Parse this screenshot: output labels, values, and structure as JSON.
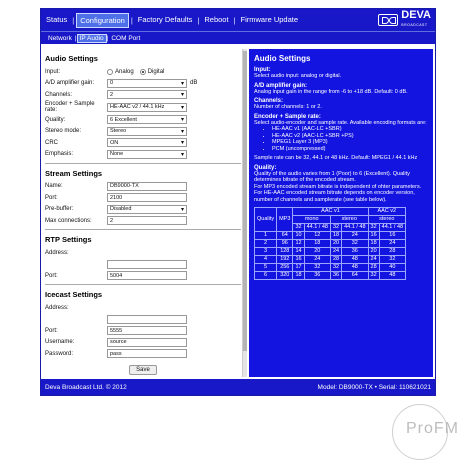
{
  "nav": {
    "items": [
      "Status",
      "Configuration",
      "Factory Defaults",
      "Reboot",
      "Firmware Update"
    ],
    "active_index": 1,
    "logo_text": "DEVA",
    "logo_sub": "BROADCAST"
  },
  "subnav": {
    "items": [
      "Network",
      "IP Audio",
      "COM Port"
    ],
    "active_index": 1
  },
  "audio": {
    "title": "Audio Settings",
    "input_label": "Input:",
    "input_options": [
      "Analog",
      "Digital"
    ],
    "input_selected": "Digital",
    "gain_label": "A/D amplifier gain:",
    "gain_value": "0",
    "gain_unit": "dB",
    "channels_label": "Channels:",
    "channels_value": "2",
    "encoder_label": "Encoder + Sample rate:",
    "encoder_value": "HE-AAC v2 / 44.1 kHz",
    "quality_label": "Quality:",
    "quality_value": "6 Excellent",
    "stereo_label": "Stereo mode:",
    "stereo_value": "Stereo",
    "crc_label": "CRC",
    "crc_value": "ON",
    "emphasis_label": "Emphasis:",
    "emphasis_value": "None"
  },
  "stream": {
    "title": "Stream Settings",
    "name_label": "Name:",
    "name_value": "DB9000-TX",
    "port_label": "Port:",
    "port_value": "2100",
    "prebuffer_label": "Pre-buffer:",
    "prebuffer_value": "Disabled",
    "maxconn_label": "Max connections:",
    "maxconn_value": "2"
  },
  "rtp": {
    "title": "RTP Settings",
    "address_label": "Address:",
    "address_value": "",
    "port_label": "Port:",
    "port_value": "5004"
  },
  "icecast": {
    "title": "Icecast Settings",
    "address_label": "Address:",
    "address_value": "",
    "port_label": "Port:",
    "port_value": "5555",
    "username_label": "Username:",
    "username_value": "source",
    "password_label": "Password:",
    "password_value": "pass"
  },
  "save_label": "Save",
  "help": {
    "title": "Audio Settings",
    "input_h": "Input:",
    "input_p": "Select audio input: analog or digital.",
    "gain_h": "A/D amplifier gain:",
    "gain_p": "Analog input gain in the range from -6 to +18 dB. Default: 0 dB.",
    "channels_h": "Channels:",
    "channels_p": "Number of channels: 1 or 2.",
    "encoder_h": "Encoder + Sample rate:",
    "encoder_p": "Select audio-encoder and sample rate. Available encoding formats are:",
    "formats": [
      "HE-AAC v1 (AAC-LC +SBR)",
      "HE-AAC v2 (AAC-LC +SBR +PS)",
      "MPEG1 Layer 3 (MP3)",
      "PCM (uncompressed)"
    ],
    "samplerate_p": "Sample rate can be 32, 44.1 or 48 kHz. Default: MPEG1 / 44.1 kHz",
    "quality_h": "Quality:",
    "quality_p1": "Quality of the audio varies from 1 (Poor) to 6 (Excellent). Quality determines bitrate of the encoded stream.",
    "quality_p2": "For MP3 encoded stream bitrate is independent of ohter parameters.",
    "quality_p3": "For HE-AAC encoded stream bitrate depends on encoder version, number of channels and samplerate (see table below).",
    "table": {
      "h_quality": "Quality",
      "h_mp3": "MP3",
      "h_aacv1": "AAC v1",
      "h_aacv2": "AAC v2",
      "h_mono": "mono",
      "h_stereo": "stereo",
      "h_stereo2": "stereo",
      "rates": [
        "32",
        "44.1 / 48",
        "32",
        "44.1 / 48",
        "32",
        "44.1 / 48"
      ],
      "rows": [
        [
          "1",
          "64",
          "10",
          "12",
          "18",
          "24",
          "16",
          "16"
        ],
        [
          "2",
          "96",
          "12",
          "18",
          "20",
          "32",
          "18",
          "24"
        ],
        [
          "3",
          "128",
          "14",
          "20",
          "24",
          "36",
          "20",
          "28"
        ],
        [
          "4",
          "192",
          "16",
          "24",
          "28",
          "48",
          "24",
          "32"
        ],
        [
          "5",
          "256",
          "17",
          "32",
          "32",
          "48",
          "28",
          "40"
        ],
        [
          "6",
          "320",
          "18",
          "36",
          "36",
          "64",
          "32",
          "48"
        ]
      ]
    }
  },
  "footer": {
    "left": "Deva Broadcast Ltd. © 2012",
    "right": "Model: DB9000-TX • Serial: 110621021"
  },
  "watermark": "ProFM"
}
